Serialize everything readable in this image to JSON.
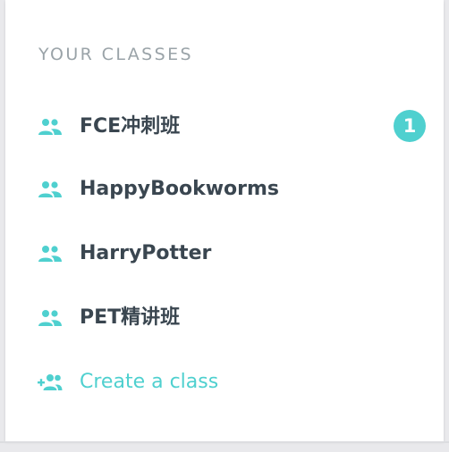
{
  "colors": {
    "accent": "#4fd0cf",
    "text": "#3a4650",
    "muted": "#9aa3a8"
  },
  "sidebar": {
    "title": "YOUR CLASSES",
    "items": [
      {
        "label": "FCE冲刺班",
        "icon": "group-icon",
        "badge": "1"
      },
      {
        "label": "HappyBookworms",
        "icon": "group-icon"
      },
      {
        "label": "HarryPotter",
        "icon": "group-icon"
      },
      {
        "label": "PET精讲班",
        "icon": "group-icon"
      }
    ],
    "create": {
      "label": "Create a class",
      "icon": "add-group-icon"
    }
  }
}
